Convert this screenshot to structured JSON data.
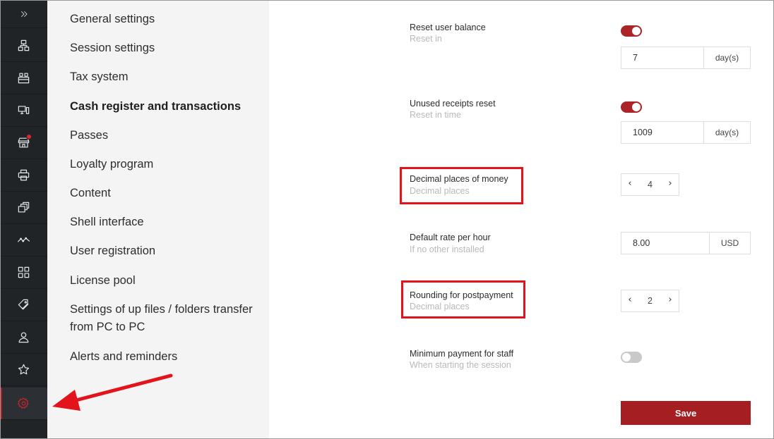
{
  "sidebar_icons": [
    {
      "name": "collapse-icon"
    },
    {
      "name": "network-icon"
    },
    {
      "name": "workstations-icon"
    },
    {
      "name": "devices-icon"
    },
    {
      "name": "shop-icon",
      "badge": true
    },
    {
      "name": "printer-icon"
    },
    {
      "name": "layers-icon"
    },
    {
      "name": "activity-icon"
    },
    {
      "name": "grid-icon"
    },
    {
      "name": "tags-icon"
    },
    {
      "name": "users-icon"
    },
    {
      "name": "star-icon"
    },
    {
      "name": "gear-icon",
      "active": true
    }
  ],
  "menu": {
    "items": [
      {
        "label": "General settings",
        "active": false
      },
      {
        "label": "Session settings",
        "active": false
      },
      {
        "label": "Tax system",
        "active": false
      },
      {
        "label": "Cash register and transactions",
        "active": true
      },
      {
        "label": "Passes",
        "active": false
      },
      {
        "label": "Loyalty program",
        "active": false
      },
      {
        "label": "Content",
        "active": false
      },
      {
        "label": "Shell interface",
        "active": false
      },
      {
        "label": "User registration",
        "active": false
      },
      {
        "label": "License pool",
        "active": false
      },
      {
        "label": "Settings of up files / folders transfer from PC to PC",
        "active": false
      },
      {
        "label": "Alerts and reminders",
        "active": false
      }
    ]
  },
  "settings": {
    "reset_balance": {
      "label": "Reset user balance",
      "sub": "Reset in",
      "enabled": true,
      "value": "7",
      "unit": "day(s)"
    },
    "unused_receipts": {
      "label": "Unused receipts reset",
      "sub": "Reset in time",
      "enabled": true,
      "value": "1009",
      "unit": "day(s)"
    },
    "decimal_money": {
      "label": "Decimal places of money",
      "sub": "Decimal places",
      "value": "4"
    },
    "default_rate": {
      "label": "Default rate per hour",
      "sub": "If no other installed",
      "value": "8.00",
      "unit": "USD"
    },
    "rounding": {
      "label": "Rounding for postpayment",
      "sub": "Decimal places",
      "value": "2"
    },
    "min_payment": {
      "label": "Minimum payment for staff",
      "sub": "When starting the session",
      "enabled": false
    }
  },
  "stepper_symbols": {
    "decrease": "‹",
    "increase": "›"
  },
  "save_label": "Save",
  "colors": {
    "accent": "#a51e22",
    "highlight": "#e3131b",
    "rail": "#212427",
    "menu_bg": "#f4f4f4"
  }
}
